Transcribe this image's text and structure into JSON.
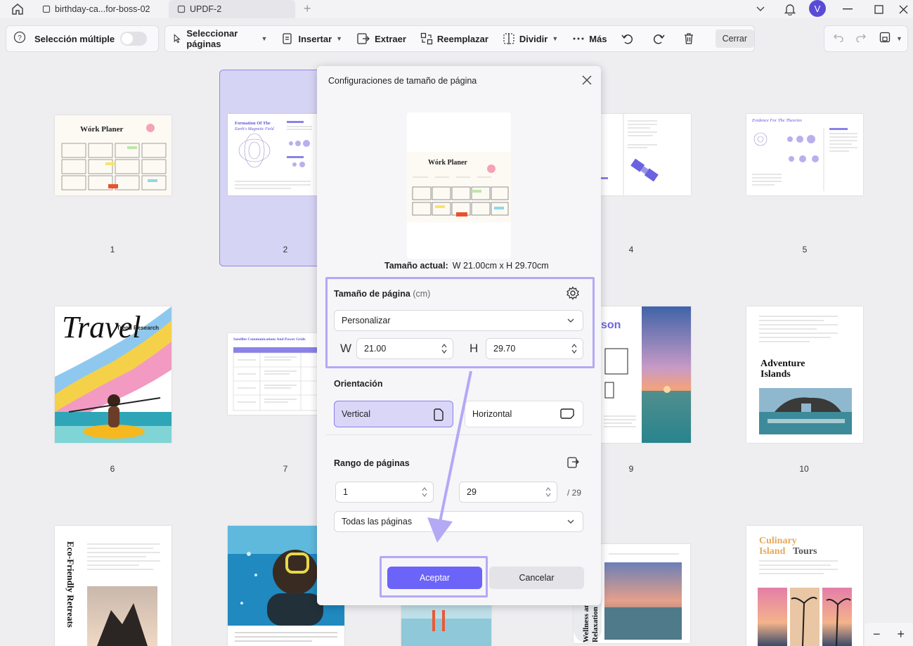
{
  "titlebar": {
    "tabs": [
      {
        "label": "birthday-ca...for-boss-02"
      },
      {
        "label": "UPDF-2"
      }
    ],
    "avatar_initial": "V"
  },
  "toolbar": {
    "multi_select_label": "Selección múltiple",
    "select_pages_label": "Seleccionar páginas",
    "insert_label": "Insertar",
    "extract_label": "Extraer",
    "replace_label": "Reemplazar",
    "split_label": "Dividir",
    "more_label": "Más",
    "close_label": "Cerrar"
  },
  "pages": [
    {
      "num": "1"
    },
    {
      "num": "2"
    },
    {
      "num": "4"
    },
    {
      "num": "5"
    },
    {
      "num": "6"
    },
    {
      "num": "7"
    },
    {
      "num": "9"
    },
    {
      "num": "10"
    }
  ],
  "thumbnails": {
    "p1_title": "Wórk Planer",
    "p2_title": "Formation Of The",
    "p2_subtitle": "Earth's Magnetic Field",
    "p5_title": "Evidence For The Theories",
    "p6_title": "Travel",
    "p6_sub": "Trend Research",
    "p7_title": "Satellite Communications And Power Grids",
    "p9_title": "son",
    "p10_title": "Adventure Islands",
    "p11_title": "Eco-Friendly Retreats",
    "p14_title": "Wellness and Relaxation",
    "p15_title_a": "Culinary",
    "p15_title_b": "Island",
    "p15_title_c": "Tours"
  },
  "dialog": {
    "title": "Configuraciones de tamaño de página",
    "preview_title": "Wórk Planer",
    "current_size_label": "Tamaño actual:",
    "current_size_value": "W 21.00cm x H 29.70cm",
    "page_size_label": "Tamaño de página",
    "page_size_unit": "(cm)",
    "size_preset": "Personalizar",
    "w_label": "W",
    "h_label": "H",
    "width": "21.00",
    "height": "29.70",
    "orientation_label": "Orientación",
    "vertical_label": "Vertical",
    "horizontal_label": "Horizontal",
    "range_label": "Rango de páginas",
    "range_from": "1",
    "range_to": "29",
    "range_total": "/ 29",
    "range_option": "Todas las páginas",
    "accept_label": "Aceptar",
    "cancel_label": "Cancelar"
  },
  "colors": {
    "accent": "#6c63f8",
    "highlight": "#b3a9f5",
    "selection_fill": "#d6d4f4"
  }
}
